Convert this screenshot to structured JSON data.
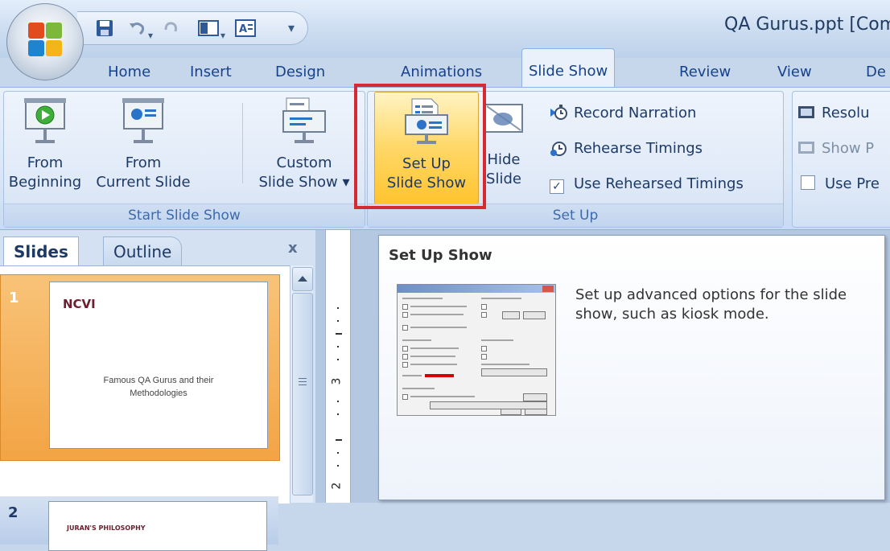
{
  "window": {
    "title": "QA Gurus.ppt [Com"
  },
  "quick_access": {
    "icons": [
      "save-icon",
      "undo-icon",
      "redo-icon",
      "layout-icon",
      "textbox-icon",
      "customize-icon"
    ]
  },
  "tabs": [
    {
      "label": "Home"
    },
    {
      "label": "Insert"
    },
    {
      "label": "Design"
    },
    {
      "label": "Animations"
    },
    {
      "label": "Slide Show",
      "active": true
    },
    {
      "label": "Review"
    },
    {
      "label": "View"
    },
    {
      "label": "De"
    }
  ],
  "ribbon": {
    "start_group": {
      "label": "Start Slide Show",
      "from_beginning": {
        "line1": "From",
        "line2": "Beginning"
      },
      "from_current": {
        "line1": "From",
        "line2": "Current Slide"
      },
      "custom": {
        "line1": "Custom",
        "line2": "Slide Show ▾"
      }
    },
    "setup_group": {
      "label": "Set Up",
      "setup_show": {
        "line1": "Set Up",
        "line2": "Slide Show"
      },
      "hide_slide": {
        "line1": "Hide",
        "line2": "Slide"
      },
      "record_narration": "Record Narration",
      "rehearse_timings": "Rehearse Timings",
      "use_rehearsed": "Use Rehearsed Timings",
      "use_rehearsed_checked": true
    },
    "monitors_group": {
      "resolution": "Resolu",
      "show_presentation": "Show P",
      "use_presenter": "Use Pre"
    }
  },
  "slides_pane": {
    "tab_slides": "Slides",
    "tab_outline": "Outline",
    "close": "x",
    "slides": [
      {
        "number": "1",
        "title": "NCVI",
        "subtitle_line1": "Famous QA Gurus and their",
        "subtitle_line2": "Methodologies",
        "selected": true
      },
      {
        "number": "2",
        "title": "JURAN'S PHILOSOPHY",
        "selected": false
      }
    ]
  },
  "ruler": {
    "label_3": "3",
    "label_2": "2"
  },
  "tooltip": {
    "title": "Set Up Show",
    "description": "Set up advanced options for the slide show, such as kiosk mode."
  },
  "colors": {
    "highlight_box": "#d52a31",
    "active_button": "#ffc42f",
    "ribbon_text": "#15428b"
  }
}
